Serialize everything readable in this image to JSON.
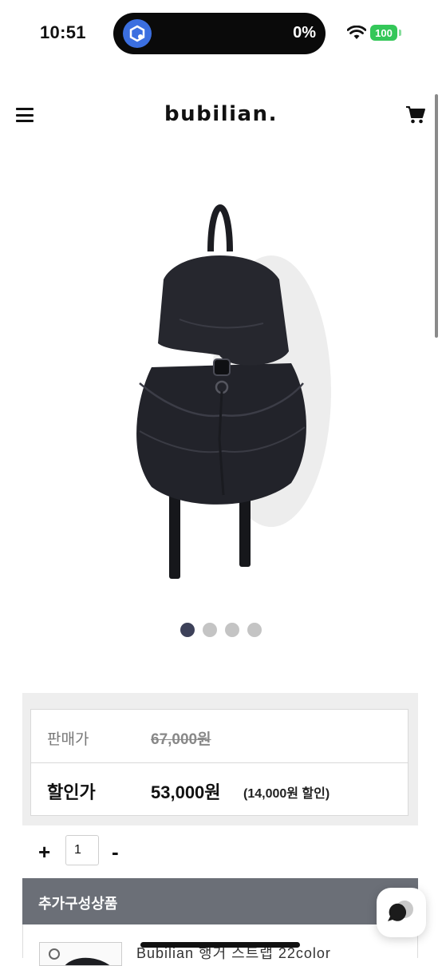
{
  "status_bar": {
    "time": "10:51",
    "island_percent": "0%",
    "battery": "100",
    "battery_color": "#34c759"
  },
  "header": {
    "logo": "bubilian.",
    "menu_icon": "hamburger-menu-icon",
    "cart_icon": "cart-icon"
  },
  "carousel": {
    "total": 4,
    "active_index": 0,
    "active_color": "#3d4159"
  },
  "price": {
    "regular_label": "판매가",
    "regular_value": "67,000원",
    "sale_label": "할인가",
    "sale_value": "53,000원",
    "discount_note": "(14,000원 할인)"
  },
  "quantity": {
    "plus_label": "+",
    "value": "1",
    "minus_label": "-"
  },
  "addon": {
    "title": "추가구성상품",
    "item_name": "Bubilian 행거 스트랩 22color"
  }
}
